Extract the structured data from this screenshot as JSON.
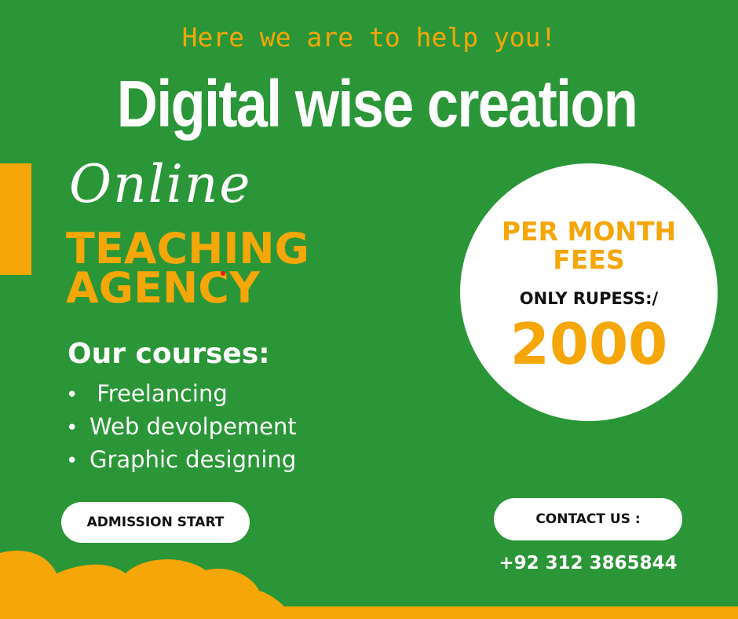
{
  "header": {
    "tagline": "Here we are to help you!",
    "title": "Digital wise creation"
  },
  "brand": {
    "script_word": "Online",
    "line1": "TEACHING",
    "line2": "AGENCY"
  },
  "courses": {
    "heading": "Our courses:",
    "items": [
      {
        "bullet": "•",
        "label": " Freelancing"
      },
      {
        "bullet": "•",
        "label": "Web devolpement"
      },
      {
        "bullet": "•",
        "label": "Graphic designing"
      }
    ]
  },
  "fees": {
    "line1": "PER MONTH",
    "line2": "FEES",
    "currency_label": "ONLY RUPESS:/",
    "amount": "2000"
  },
  "buttons": {
    "admission": "ADMISSION START",
    "contact": "CONTACT US :"
  },
  "contact": {
    "phone": "+92 312 3865844"
  },
  "colors": {
    "background": "#2a9637",
    "accent": "#f5a608",
    "white": "#ffffff",
    "text_dark": "#111111",
    "dot": "#e21b1b"
  }
}
